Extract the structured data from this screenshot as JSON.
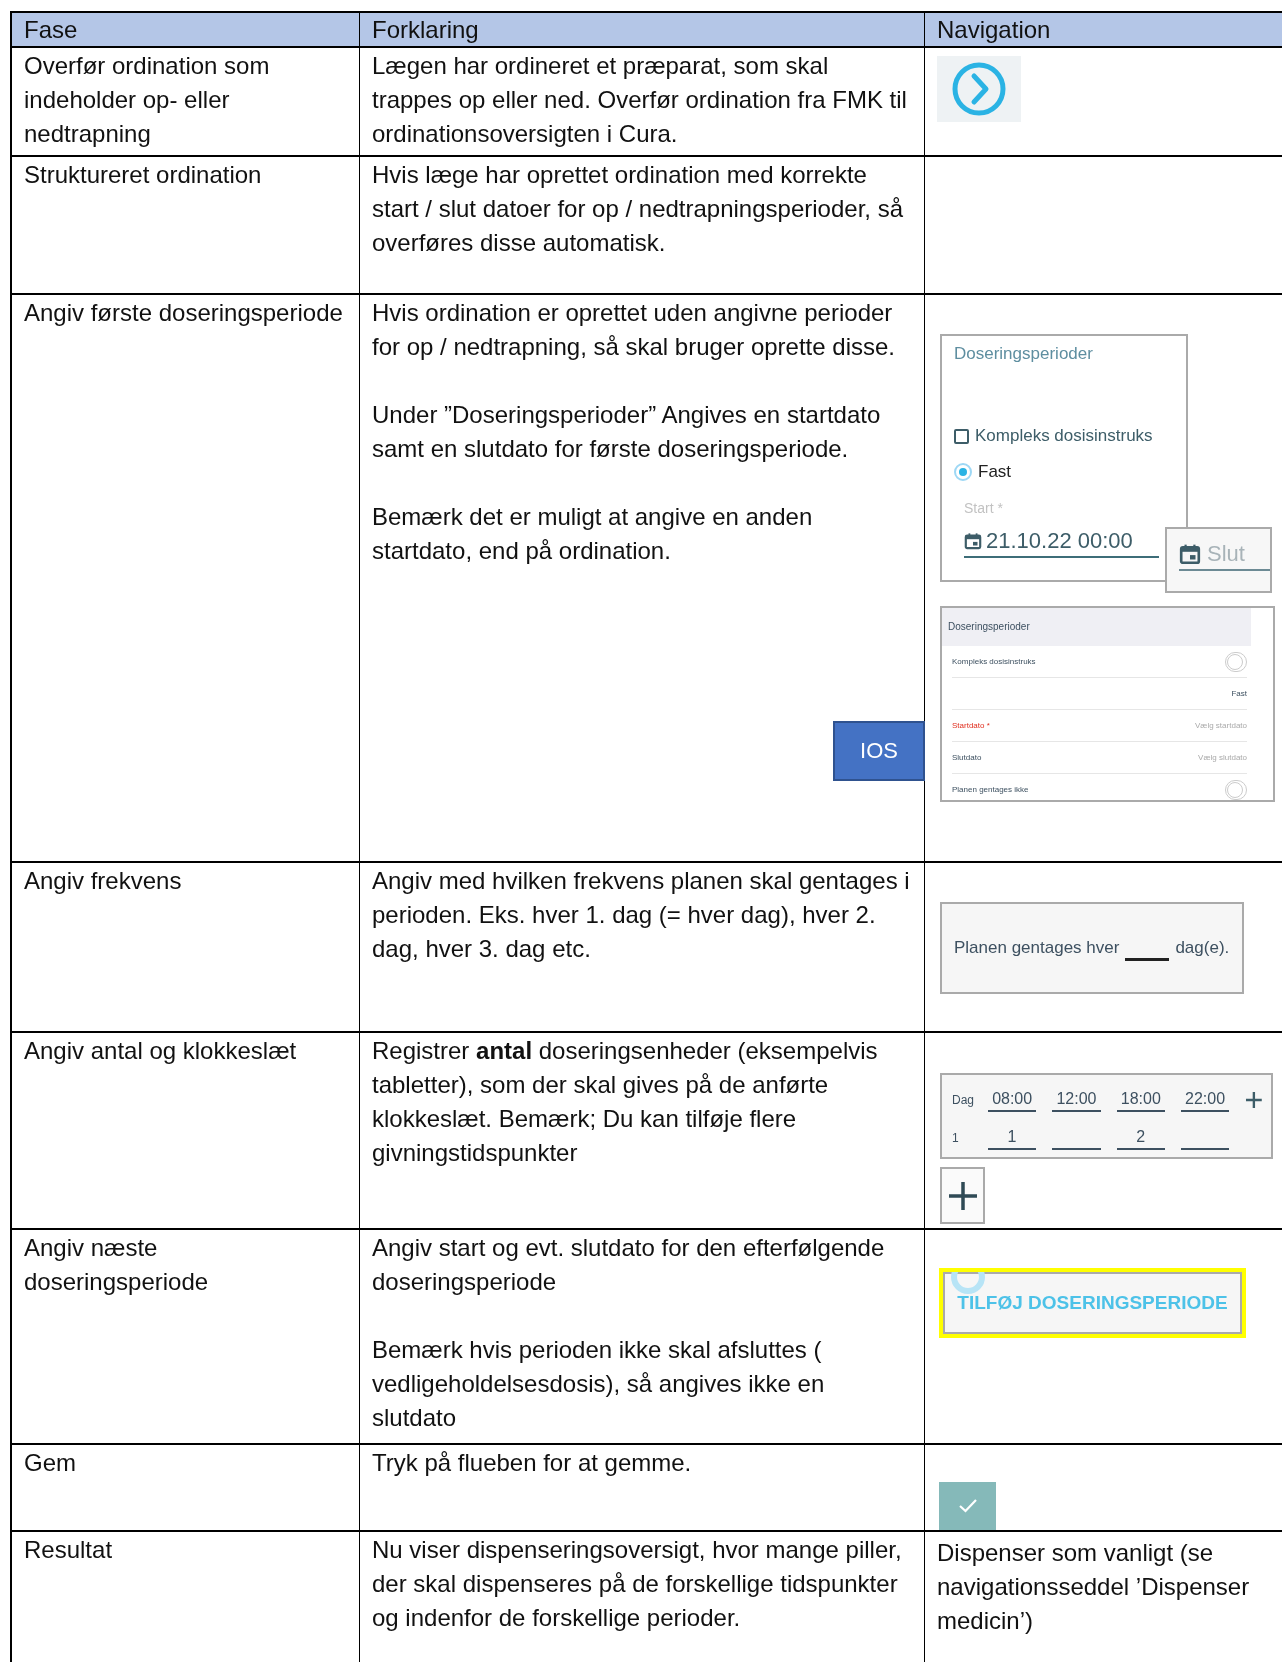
{
  "table": {
    "columns": [
      "Fase",
      "Forklaring",
      "Navigation"
    ],
    "rows": [
      {
        "phase": "Overfør ordination som indeholder op- eller nedtrapning",
        "explanation": [
          "Lægen har ordineret et præparat, som skal trappes op eller ned. Overfør ordination fra FMK til ordinationsoversigten i Cura."
        ],
        "navigation": {
          "kind": "next"
        }
      },
      {
        "phase": "Struktureret ordination",
        "explanation": [
          "Hvis læge har oprettet ordination med korrekte start / slut datoer for op / nedtrapningsperioder, så overføres disse automatisk."
        ],
        "navigation": {
          "kind": "empty"
        }
      },
      {
        "phase": "Angiv første doseringsperiode",
        "explanation": [
          "Hvis ordination er oprettet uden angivne perioder for op / nedtrapning, så skal bruger oprette disse.",
          "Under ”Doseringsperioder” Angives en startdato samt en slutdato for første doseringsperiode.",
          "Bemærk det er muligt at angive en anden startdato, end på ordination."
        ],
        "badge": "IOS",
        "navigation": {
          "kind": "periods",
          "android": {
            "title": "Doseringsperioder",
            "checkbox": {
              "label": "Kompleks dosisinstruks",
              "checked": false
            },
            "radio": {
              "label": "Fast",
              "selected": true
            },
            "start_label": "Start *",
            "start_value": "21.10.22 00:00",
            "end_placeholder": "Slut"
          },
          "ios": {
            "title": "Doseringsperioder",
            "rows": [
              {
                "kind": "toggle",
                "label": "Kompleks dosisinstruks",
                "on": false
              },
              {
                "kind": "value",
                "value": "Fast"
              },
              {
                "kind": "field",
                "label": "Startdato *",
                "required": true,
                "placeholder": "Vælg startdato"
              },
              {
                "kind": "field",
                "label": "Slutdato",
                "required": false,
                "placeholder": "Vælg slutdato"
              },
              {
                "kind": "toggle",
                "label": "Planen gentages ikke",
                "on": false
              }
            ]
          }
        }
      },
      {
        "phase": "Angiv frekvens",
        "explanation": [
          "Angiv med hvilken frekvens planen skal gentages i perioden. Eks. hver 1. dag (= hver dag), hver 2. dag, hver 3. dag etc."
        ],
        "navigation": {
          "kind": "frequency",
          "before": "Planen gentages hver",
          "after": "dag(e)."
        }
      },
      {
        "phase": "Angiv antal og klokkeslæt",
        "explanation": [
          "Registrer **antal** doseringsenheder (eksempelvis tabletter), som der skal gives på de anførte klokkeslæt. Bemærk; Du kan tilføje flere givningstidspunkter"
        ],
        "navigation": {
          "kind": "times",
          "day_label": "Dag",
          "times": [
            "08:00",
            "12:00",
            "18:00",
            "22:00"
          ],
          "row_label": "1",
          "amounts": [
            {
              "kind": "value",
              "value": "1"
            },
            {
              "kind": "empty"
            },
            {
              "kind": "value",
              "value": "2"
            },
            {
              "kind": "empty"
            }
          ]
        }
      },
      {
        "phase": "Angiv næste doseringsperiode",
        "explanation": [
          "Angiv start og evt. slutdato for den efterfølgende doseringsperiode",
          "Bemærk hvis perioden ikke skal afsluttes ( vedligeholdelsesdosis), så angives ikke en slutdato"
        ],
        "navigation": {
          "kind": "add_period",
          "label": "TILFØJ DOSERINGSPERIODE"
        }
      },
      {
        "phase": "Gem",
        "explanation": [
          "Tryk på flueben for at gemme."
        ],
        "navigation": {
          "kind": "save"
        }
      },
      {
        "phase": "Resultat",
        "explanation": [
          "Nu viser dispenseringsoversigt,  hvor mange piller, der skal dispenseres på de forskellige tidspunkter og indenfor de forskellige perioder."
        ],
        "navigation": {
          "kind": "text",
          "paragraphs": [
            "Dispenser som vanligt (se navigationsseddel ’Dispenser medicin’)"
          ]
        }
      }
    ]
  }
}
